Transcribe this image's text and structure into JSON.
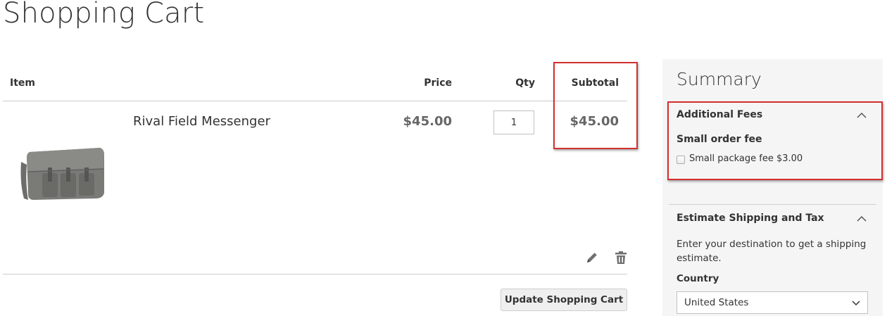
{
  "page": {
    "title": "Shopping Cart"
  },
  "cart": {
    "columns": {
      "item": "Item",
      "price": "Price",
      "qty": "Qty",
      "subtotal": "Subtotal"
    },
    "items": [
      {
        "name": "Rival Field Messenger",
        "price": "$45.00",
        "qty": "1",
        "subtotal": "$45.00",
        "image": "messenger-bag-icon"
      }
    ],
    "actions": {
      "edit_icon": "pencil-icon",
      "delete_icon": "trash-icon"
    },
    "update_button": "Update Shopping Cart"
  },
  "summary": {
    "title": "Summary",
    "additional_fees": {
      "title": "Additional Fees",
      "group_label": "Small order fee",
      "option_label": "Small package fee $3.00",
      "checked": false
    },
    "shipping": {
      "title": "Estimate Shipping and Tax",
      "description": "Enter your destination to get a shipping estimate.",
      "country_label": "Country",
      "country_value": "United States"
    }
  },
  "colors": {
    "highlight": "#d32f2f",
    "summary_background": "#f5f5f5",
    "button_background": "#efefef",
    "price_text": "#666666"
  }
}
